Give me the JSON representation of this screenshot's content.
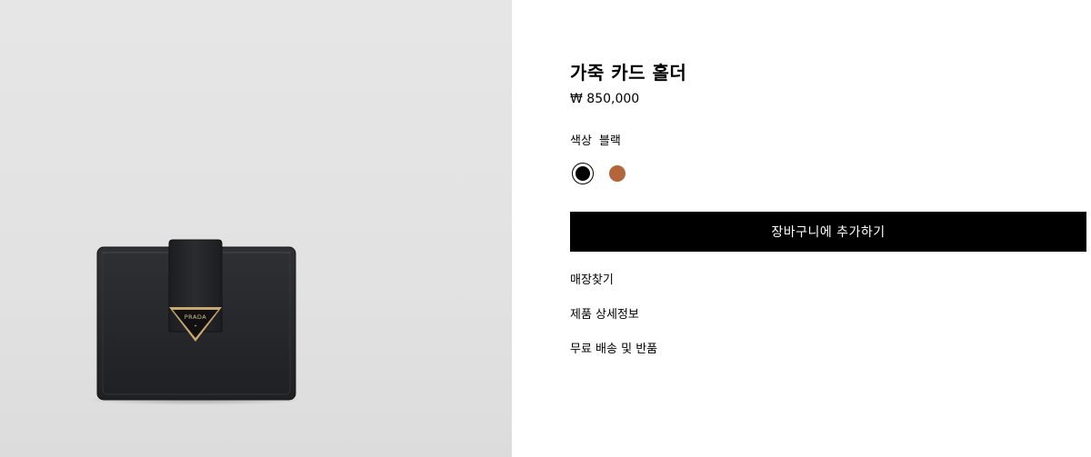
{
  "product": {
    "title": "가죽 카드 홀더",
    "price": "₩ 850,000",
    "brand_logo": "PRADA",
    "image_icon": "card-holder-product-image"
  },
  "color": {
    "label": "색상",
    "selected_value": "블랙",
    "swatches": [
      {
        "name": "black",
        "hex": "#000000",
        "selected": true
      },
      {
        "name": "brown",
        "hex": "#b5653a",
        "selected": false
      }
    ]
  },
  "actions": {
    "add_to_cart_label": "장바구니에 추가하기"
  },
  "links": {
    "find_store": "매장찾기",
    "product_details": "제품 상세정보",
    "shipping_returns": "무료 배송 및 반품"
  },
  "colors": {
    "background_left": "#e3e3e3",
    "button_bg": "#000000",
    "button_text": "#ffffff"
  }
}
